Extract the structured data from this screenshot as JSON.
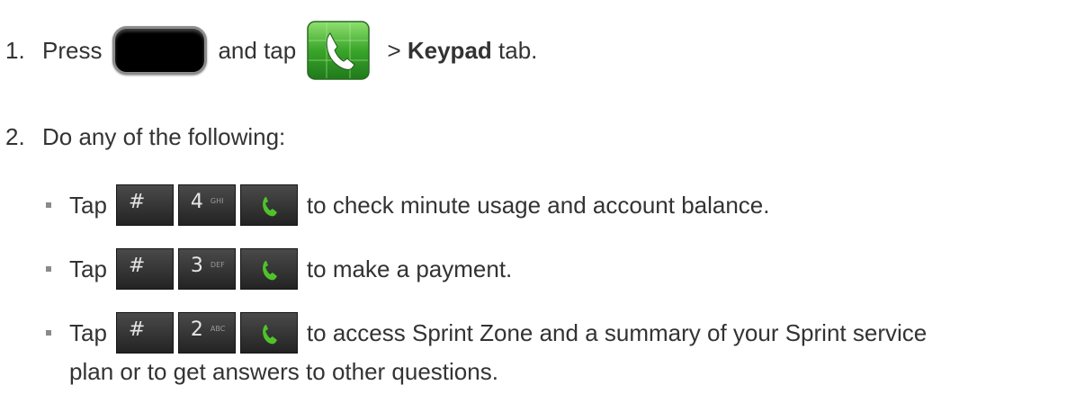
{
  "steps": [
    {
      "number": "1.",
      "text_before": "Press",
      "text_middle": "and tap",
      "text_after": " > ",
      "bold": "Keypad",
      "text_end": " tab."
    },
    {
      "number": "2.",
      "text": "Do any of the following:"
    }
  ],
  "substeps": [
    {
      "prefix": "Tap",
      "keys": [
        {
          "char": "#",
          "sub": ""
        },
        {
          "char": "4",
          "sub": "GHI"
        }
      ],
      "text": "to check minute usage and account balance.",
      "continuation": ""
    },
    {
      "prefix": "Tap",
      "keys": [
        {
          "char": "#",
          "sub": ""
        },
        {
          "char": "3",
          "sub": "DEF"
        }
      ],
      "text": "to make a payment.",
      "continuation": ""
    },
    {
      "prefix": "Tap",
      "keys": [
        {
          "char": "#",
          "sub": ""
        },
        {
          "char": "2",
          "sub": "ABC"
        }
      ],
      "text": "to access Sprint Zone and a summary of your Sprint service",
      "continuation": "plan or to get answers to other questions."
    }
  ],
  "icons": {
    "home_button": "home-button-icon",
    "phone_app": "phone-app-icon",
    "call_key": "phone-call-icon"
  },
  "colors": {
    "text": "#333333",
    "key_bg": "#2f2f2f",
    "call_green": "#4fc22a",
    "app_green": "#3a9a2a",
    "bullet": "#8a8a8a"
  }
}
